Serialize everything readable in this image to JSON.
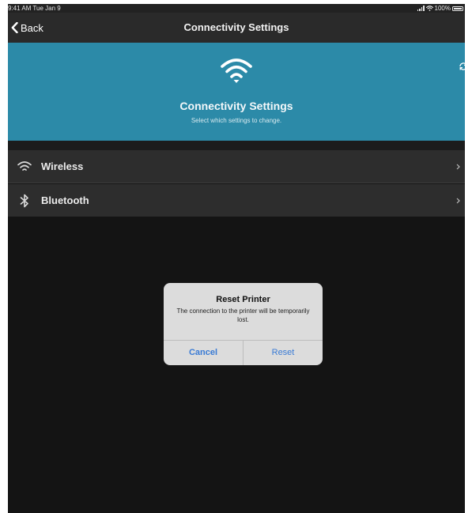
{
  "status_bar": {
    "time_date": "9:41 AM  Tue Jan 9",
    "battery": "100%"
  },
  "nav": {
    "back_label": "Back",
    "title": "Connectivity Settings"
  },
  "header": {
    "title": "Connectivity Settings",
    "subtitle": "Select which settings to change."
  },
  "settings": {
    "items": [
      {
        "label": "Wireless",
        "icon": "wifi-icon"
      },
      {
        "label": "Bluetooth",
        "icon": "bluetooth-icon"
      }
    ]
  },
  "alert": {
    "title": "Reset Printer",
    "message": "The connection to the printer will be temporarily lost.",
    "cancel_label": "Cancel",
    "confirm_label": "Reset"
  },
  "colors": {
    "header_bg": "#2c8aa8",
    "alert_button": "#3a7bd5",
    "background": "#141414"
  }
}
